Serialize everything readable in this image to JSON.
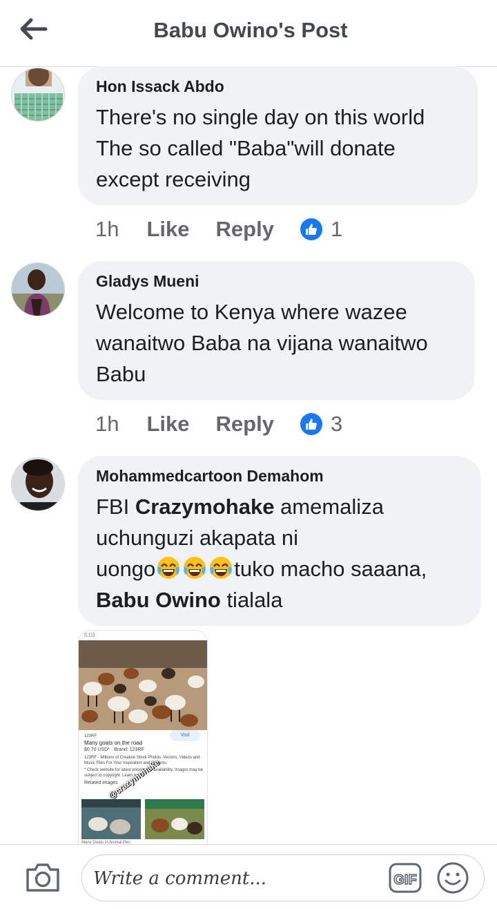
{
  "header": {
    "title": "Babu Owino's Post"
  },
  "comments": [
    {
      "author": "Hon Issack Abdo",
      "text_lines": [
        "There's no single day on this world",
        "The so called \"Baba\"will donate",
        "except receiving"
      ],
      "time": "1h",
      "like_label": "Like",
      "reply_label": "Reply",
      "reaction_count": "1"
    },
    {
      "author": "Gladys Mueni",
      "text_lines": [
        "Welcome to Kenya where wazee",
        "wanaitwo Baba na vijana wanaitwo",
        "Babu"
      ],
      "time": "1h",
      "like_label": "Like",
      "reply_label": "Reply",
      "reaction_count": "3"
    },
    {
      "author": "Mohammedcartoon Demahom",
      "segments": {
        "l1_a": "FBI ",
        "l1_b": "Crazymohake",
        "l1_c": " amemaliza",
        "l2": "uchunguzi akapata ni",
        "l3_a": "uongo",
        "l3_b": "tuko macho saaana,",
        "l4_a": "Babu Owino",
        "l4_b": " tialala"
      },
      "emoji": [
        "joy-emoji",
        "joy-emoji",
        "joy-emoji"
      ]
    }
  ],
  "attachment": {
    "status": "5:03 ",
    "source": "123RF",
    "title": "Many goats on the road",
    "price": "$0.70 USD* · Brand: 123RF",
    "desc": "123RF - Millions of Creative Stock Photos, Vectors, Videos and Music Files For Your Inspiration and Projects.",
    "note": "* Check website for latest pricing and availability. Images may be subject to copyright. Learn more",
    "visit": "Visit",
    "related": "Related images",
    "watermark": "@crazymohake",
    "caption": "Many Goats in Animal Pen"
  },
  "composer": {
    "placeholder": "Write a comment...",
    "gif_label": "GIF"
  },
  "colors": {
    "like_blue": "#1877f2",
    "bubble_bg": "#f0f2f5",
    "meta_gray": "#65676b"
  }
}
